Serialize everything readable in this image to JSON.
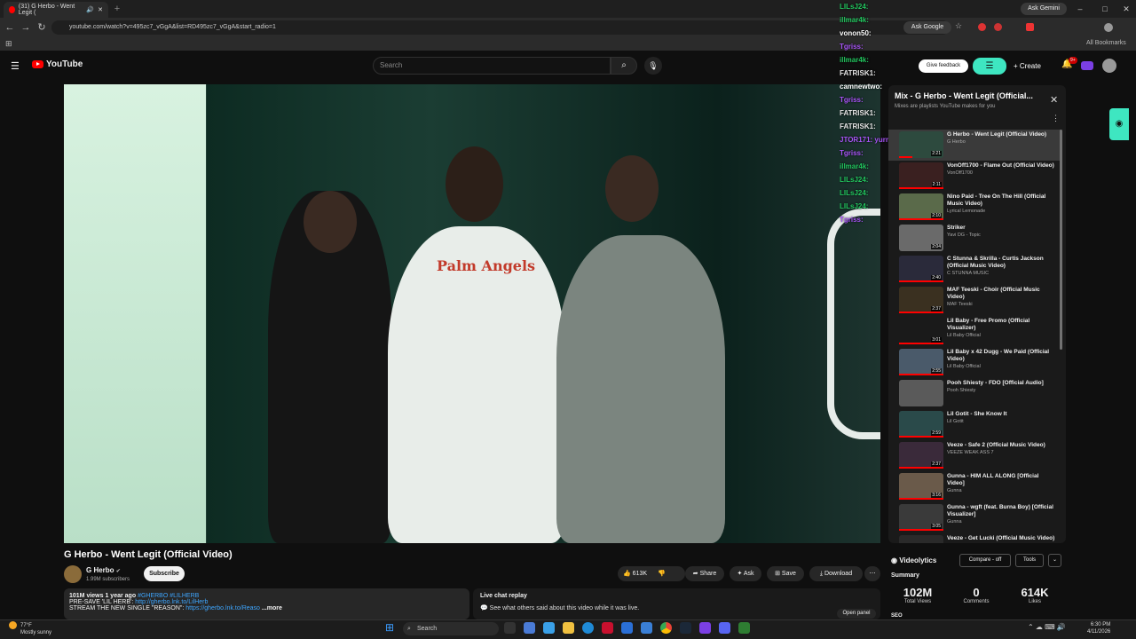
{
  "browser": {
    "tab_title": "(31) G Herbo - Went Legit (",
    "url": "youtube.com/watch?v=495zc7_vGgA&list=RD495zc7_vGgA&start_radio=1",
    "ask_gemini": "Ask Gemini",
    "ask_google": "Ask Google",
    "all_bookmarks": "All Bookmarks"
  },
  "header": {
    "logo_text": "YouTube",
    "search_placeholder": "Search",
    "give_feedback": "Give feedback",
    "create": "Create",
    "notif_count": "9+"
  },
  "chat": [
    {
      "user": "LILsJ24:",
      "color": "#22c55e"
    },
    {
      "user": "illmar4k:",
      "color": "#22c55e"
    },
    {
      "user": "vonon50:",
      "color": "#ffffff"
    },
    {
      "user": "Tgriss:",
      "color": "#a855f7"
    },
    {
      "user": "illmar4k:",
      "color": "#22c55e"
    },
    {
      "user": "FATRISK1:",
      "color": "#e5e5e5"
    },
    {
      "user": "camnewtwo:",
      "color": "#ffffff"
    },
    {
      "user": "Tgriss:",
      "color": "#a855f7"
    },
    {
      "user": "FATRISK1:",
      "color": "#e5e5e5"
    },
    {
      "user": "FATRISK1:",
      "color": "#e5e5e5"
    },
    {
      "user": "JTOR171: yurr",
      "color": "#a855f7"
    },
    {
      "user": "Tgriss:",
      "color": "#a855f7"
    },
    {
      "user": "illmar4k:",
      "color": "#22c55e"
    },
    {
      "user": "LILsJ24:",
      "color": "#22c55e"
    },
    {
      "user": "LILsJ24:",
      "color": "#22c55e"
    },
    {
      "user": "LILsJ24:",
      "color": "#22c55e"
    },
    {
      "user": "Tgriss:",
      "color": "#a855f7"
    }
  ],
  "video": {
    "title": "G Herbo - Went Legit (Official Video)",
    "channel": "G Herbo",
    "subscribers": "1.99M subscribers",
    "subscribe": "Subscribe",
    "likes": "613K",
    "share": "Share",
    "ask": "Ask",
    "save": "Save",
    "download": "Download",
    "shirt_text": "Palm Angels"
  },
  "description": {
    "stats": "101M views  1 year ago",
    "tags": "#GHERBO #LILHERB",
    "line2_prefix": "PRE-SAVE 'LIL HERB':",
    "line2_link": "http://gherbo.lnk.to/LilHerb",
    "line3_prefix": "STREAM THE NEW SINGLE \"REASON\":",
    "line3_link": "https://gherbo.lnk.to/Reaso",
    "more": "...more"
  },
  "live_chat": {
    "title": "Live chat replay",
    "text": "See what others said about this video while it was live.",
    "open_panel": "Open panel"
  },
  "playlist": {
    "title": "Mix - G Herbo - Went Legit (Official...",
    "subtitle": "Mixes are playlists YouTube makes for you",
    "items": [
      {
        "title": "G Herbo - Went Legit (Official Video)",
        "channel": "G Herbo",
        "duration": "2:21",
        "color": "#2d4a3e",
        "progress": 0.3
      },
      {
        "title": "VonOff1700 - Flame Out (Official Video)",
        "channel": "VonOff1700",
        "duration": "2:11",
        "color": "#3a2020",
        "progress": 1
      },
      {
        "title": "Nino Paid - Tree On The Hill (Official Music Video)",
        "channel": "Lyrical Lemonade",
        "duration": "2:10",
        "color": "#5a6a4a",
        "progress": 1
      },
      {
        "title": "Striker",
        "channel": "Yavi DG - Topic",
        "duration": "2:04",
        "color": "#6a6a6a",
        "progress": 0
      },
      {
        "title": "C Stunna & Skrilla - Curtis Jackson (Official Music Video)",
        "channel": "C STUNNA MUSIC",
        "duration": "2:40",
        "color": "#2a2a3a",
        "progress": 1
      },
      {
        "title": "MAF Teeski - Choir (Official Music Video)",
        "channel": "MAF Teeski",
        "duration": "2:37",
        "color": "#3a3020",
        "progress": 1
      },
      {
        "title": "Lil Baby - Free Promo (Official Visualizer)",
        "channel": "Lil Baby Official",
        "duration": "3:01",
        "color": "#1a1a1a",
        "progress": 1
      },
      {
        "title": "Lil Baby x 42 Dugg - We Paid (Official Video)",
        "channel": "Lil Baby Official",
        "duration": "2:55",
        "color": "#4a5a6a",
        "progress": 1
      },
      {
        "title": "Pooh Shiesty - FDO [Official Audio]",
        "channel": "Pooh Shiesty",
        "duration": "",
        "color": "#5a5a5a",
        "progress": 0
      },
      {
        "title": "Lil Gotit - She Know It",
        "channel": "Lil Gotit",
        "duration": "2:59",
        "color": "#2a4a4a",
        "progress": 1
      },
      {
        "title": "Veeze - Safe 2 (Official Music Video)",
        "channel": "VEEZE WEAK ASS 7",
        "duration": "2:37",
        "color": "#3a2a3a",
        "progress": 1
      },
      {
        "title": "Gunna - HIM ALL ALONG [Official Video]",
        "channel": "Gunna",
        "duration": "3:16",
        "color": "#6a5a4a",
        "progress": 1
      },
      {
        "title": "Gunna - wgft (feat. Burna Boy) [Official Visualizer]",
        "channel": "Gunna",
        "duration": "3:05",
        "color": "#3a3a3a",
        "progress": 1
      },
      {
        "title": "Veeze - Get Lucki (Official Music Video)",
        "channel": "",
        "duration": "",
        "color": "#2a2a2a",
        "progress": 0
      }
    ]
  },
  "videolytics": {
    "title": "Videolytics",
    "compare": "Compare - off",
    "tools": "Tools",
    "summary": "Summary",
    "views": "102M",
    "views_label": "Total Views",
    "comments": "0",
    "comments_label": "Comments",
    "likes": "614K",
    "likes_label": "Likes",
    "seo": "SEO"
  },
  "taskbar": {
    "temp": "77°F",
    "weather": "Mostly sunny",
    "search": "Search",
    "time": "6:30 PM",
    "date": "4/11/2026"
  }
}
